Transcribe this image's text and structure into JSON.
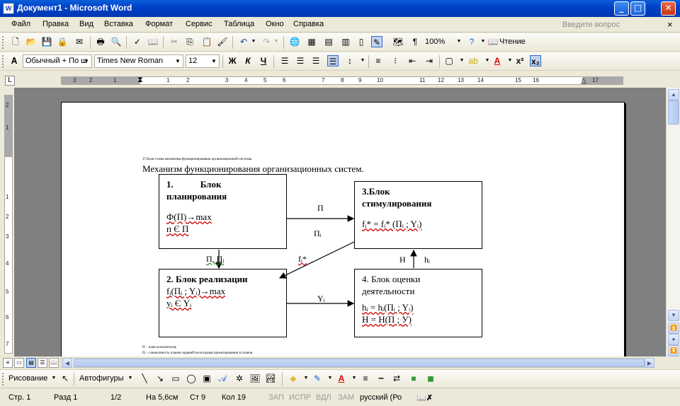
{
  "window": {
    "title": "Документ1 - Microsoft Word",
    "icon_letter": "W",
    "controls": [
      "_",
      "□",
      "✕"
    ]
  },
  "menu": {
    "items": [
      "Файл",
      "Правка",
      "Вид",
      "Вставка",
      "Формат",
      "Сервис",
      "Таблица",
      "Окно",
      "Справка"
    ],
    "ask_placeholder": "Введите вопрос",
    "close_glyph": "×"
  },
  "standard_toolbar": {
    "zoom": "100%",
    "read_label": "Чтение"
  },
  "format_toolbar": {
    "style": "Обычный + По ш",
    "font": "Times New Roman",
    "size": "12",
    "bold": "Ж",
    "italic": "К",
    "underline": "Ч"
  },
  "ruler": {
    "h_numbers": [
      "3",
      "2",
      "1",
      "1",
      "2",
      "3",
      "4",
      "5",
      "6",
      "7",
      "8",
      "9",
      "10",
      "11",
      "12",
      "13",
      "14",
      "15",
      "16",
      "17"
    ],
    "v_numbers": [
      "2",
      "1",
      "1",
      "2",
      "3",
      "4",
      "5",
      "6",
      "7"
    ]
  },
  "document": {
    "caption_top": "27.Блок-схема механизма функционирования организационной системы.",
    "heading": "Механизм функционирования организационных систем.",
    "block1": {
      "num": "1.",
      "title_a": "Блок",
      "title_b": "планирования",
      "line1": "Ф(П)→max",
      "line2": "п Є П"
    },
    "block2": {
      "title": "2. Блок реализации",
      "line1": "fᵢ(Пᵢ ; Yᵢ)→max",
      "line2": "yᵢ Є Yᵢ"
    },
    "block3": {
      "title_a": "3.Блок",
      "title_b": "стимулирования",
      "line1": "fᵢ* = fᵢ* (Пᵢ ; Yᵢ)"
    },
    "block4": {
      "title_a": "4. Блок оценки",
      "title_b": "деятельности",
      "line1": "hᵢ = hᵢ(Пᵢ ; Yᵢ)",
      "line2": "H = H(П ; У)"
    },
    "labels": {
      "p_arrow": "П",
      "pi_arrow": "Пᵢ",
      "p_pi": "П, Пᵢ",
      "fi_star": "fᵢ*",
      "yi": "Yᵢ",
      "h": "H",
      "hi": "hᵢ"
    },
    "footnote1": "П – план исполнителя;",
    "footnote2": "Пᵢ – совокупность планов заданий на исходная проектирования и планов"
  },
  "draw_toolbar": {
    "draw_label": "Рисование",
    "autoshapes_label": "Автофигуры"
  },
  "status": {
    "page": "Стр. 1",
    "section": "Разд 1",
    "pages": "1/2",
    "at": "На 5,6см",
    "line": "Ст 9",
    "col": "Кол 19",
    "rec": "ЗАП",
    "trk": "ИСПР",
    "ext": "ВДЛ",
    "ovr": "ЗАМ",
    "lang": "русский (Ро"
  }
}
